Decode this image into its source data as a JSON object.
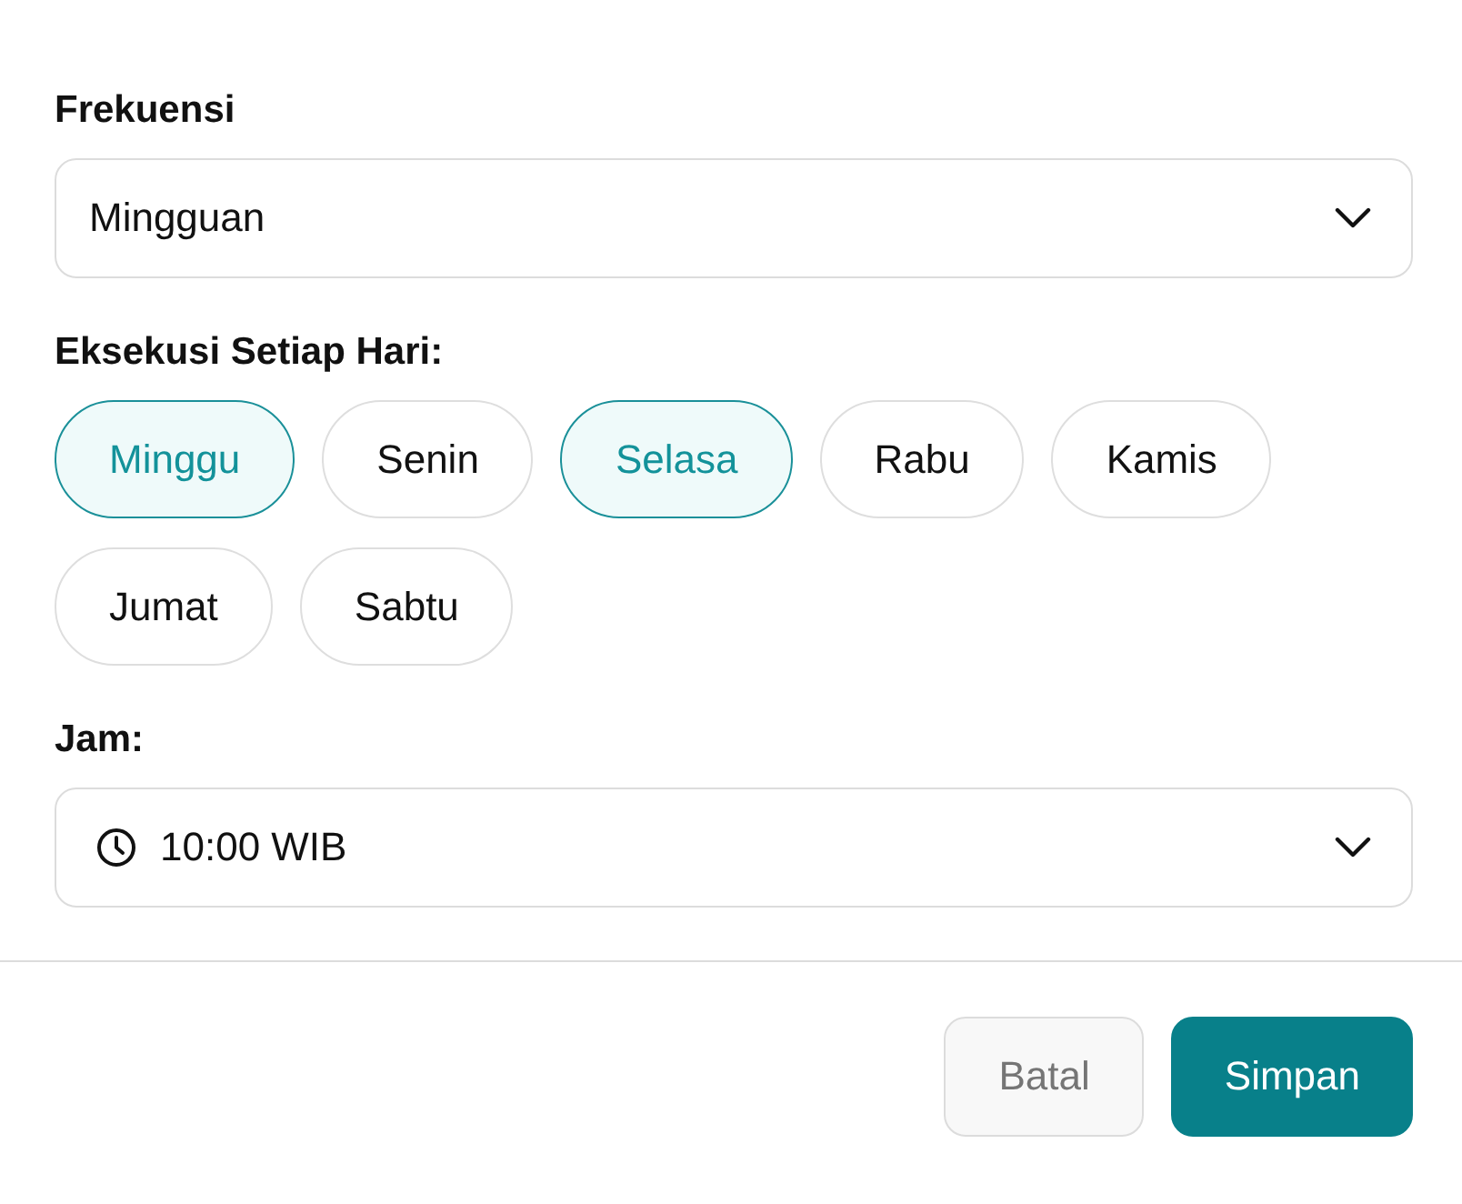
{
  "frequency": {
    "label": "Frekuensi",
    "value": "Mingguan"
  },
  "days": {
    "label": "Eksekusi Setiap Hari:",
    "items": [
      {
        "label": "Minggu",
        "selected": true
      },
      {
        "label": "Senin",
        "selected": false
      },
      {
        "label": "Selasa",
        "selected": true
      },
      {
        "label": "Rabu",
        "selected": false
      },
      {
        "label": "Kamis",
        "selected": false
      },
      {
        "label": "Jumat",
        "selected": false
      },
      {
        "label": "Sabtu",
        "selected": false
      }
    ]
  },
  "time": {
    "label": "Jam:",
    "value": "10:00 WIB"
  },
  "buttons": [
    {
      "label": "Batal",
      "kind": "secondary"
    },
    {
      "label": "Simpan",
      "kind": "primary"
    }
  ]
}
